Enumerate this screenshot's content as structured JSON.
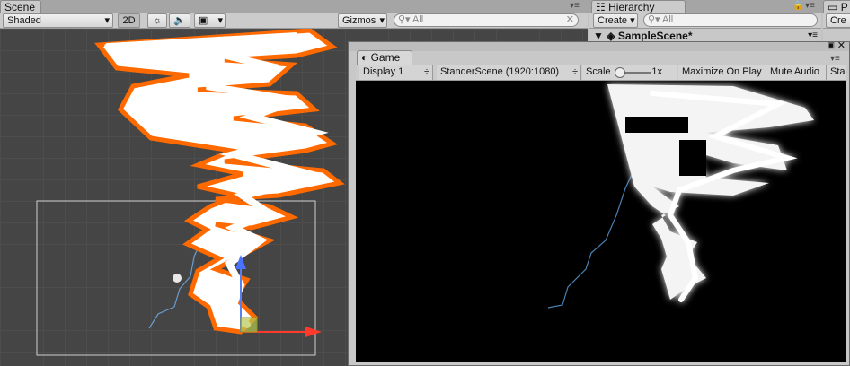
{
  "scene": {
    "tab_label": "Scene",
    "shading_mode": "Shaded",
    "mode_2d": "2D",
    "gizmos_label": "Gizmos",
    "search_placeholder": "All"
  },
  "hierarchy": {
    "tab_label": "Hierarchy",
    "create_label": "Create",
    "search_placeholder": "All",
    "scene_name": "SampleScene*"
  },
  "right_panel": {
    "tab_label": "P",
    "create_label": "Cre"
  },
  "game": {
    "tab_label": "Game",
    "display": "Display 1",
    "resolution": "StanderScene (1920:1080)",
    "scale_label": "Scale",
    "scale_value": "1x",
    "maximize_label": "Maximize On Play",
    "mute_label": "Mute Audio",
    "stats_label": "Sta"
  },
  "colors": {
    "editor_bg": "#c2c2c2",
    "scene_bg": "#454545",
    "lightning_outline": "#ff6a00",
    "bolt_core": "#ffffff",
    "guide_line": "#4a7fb0"
  }
}
